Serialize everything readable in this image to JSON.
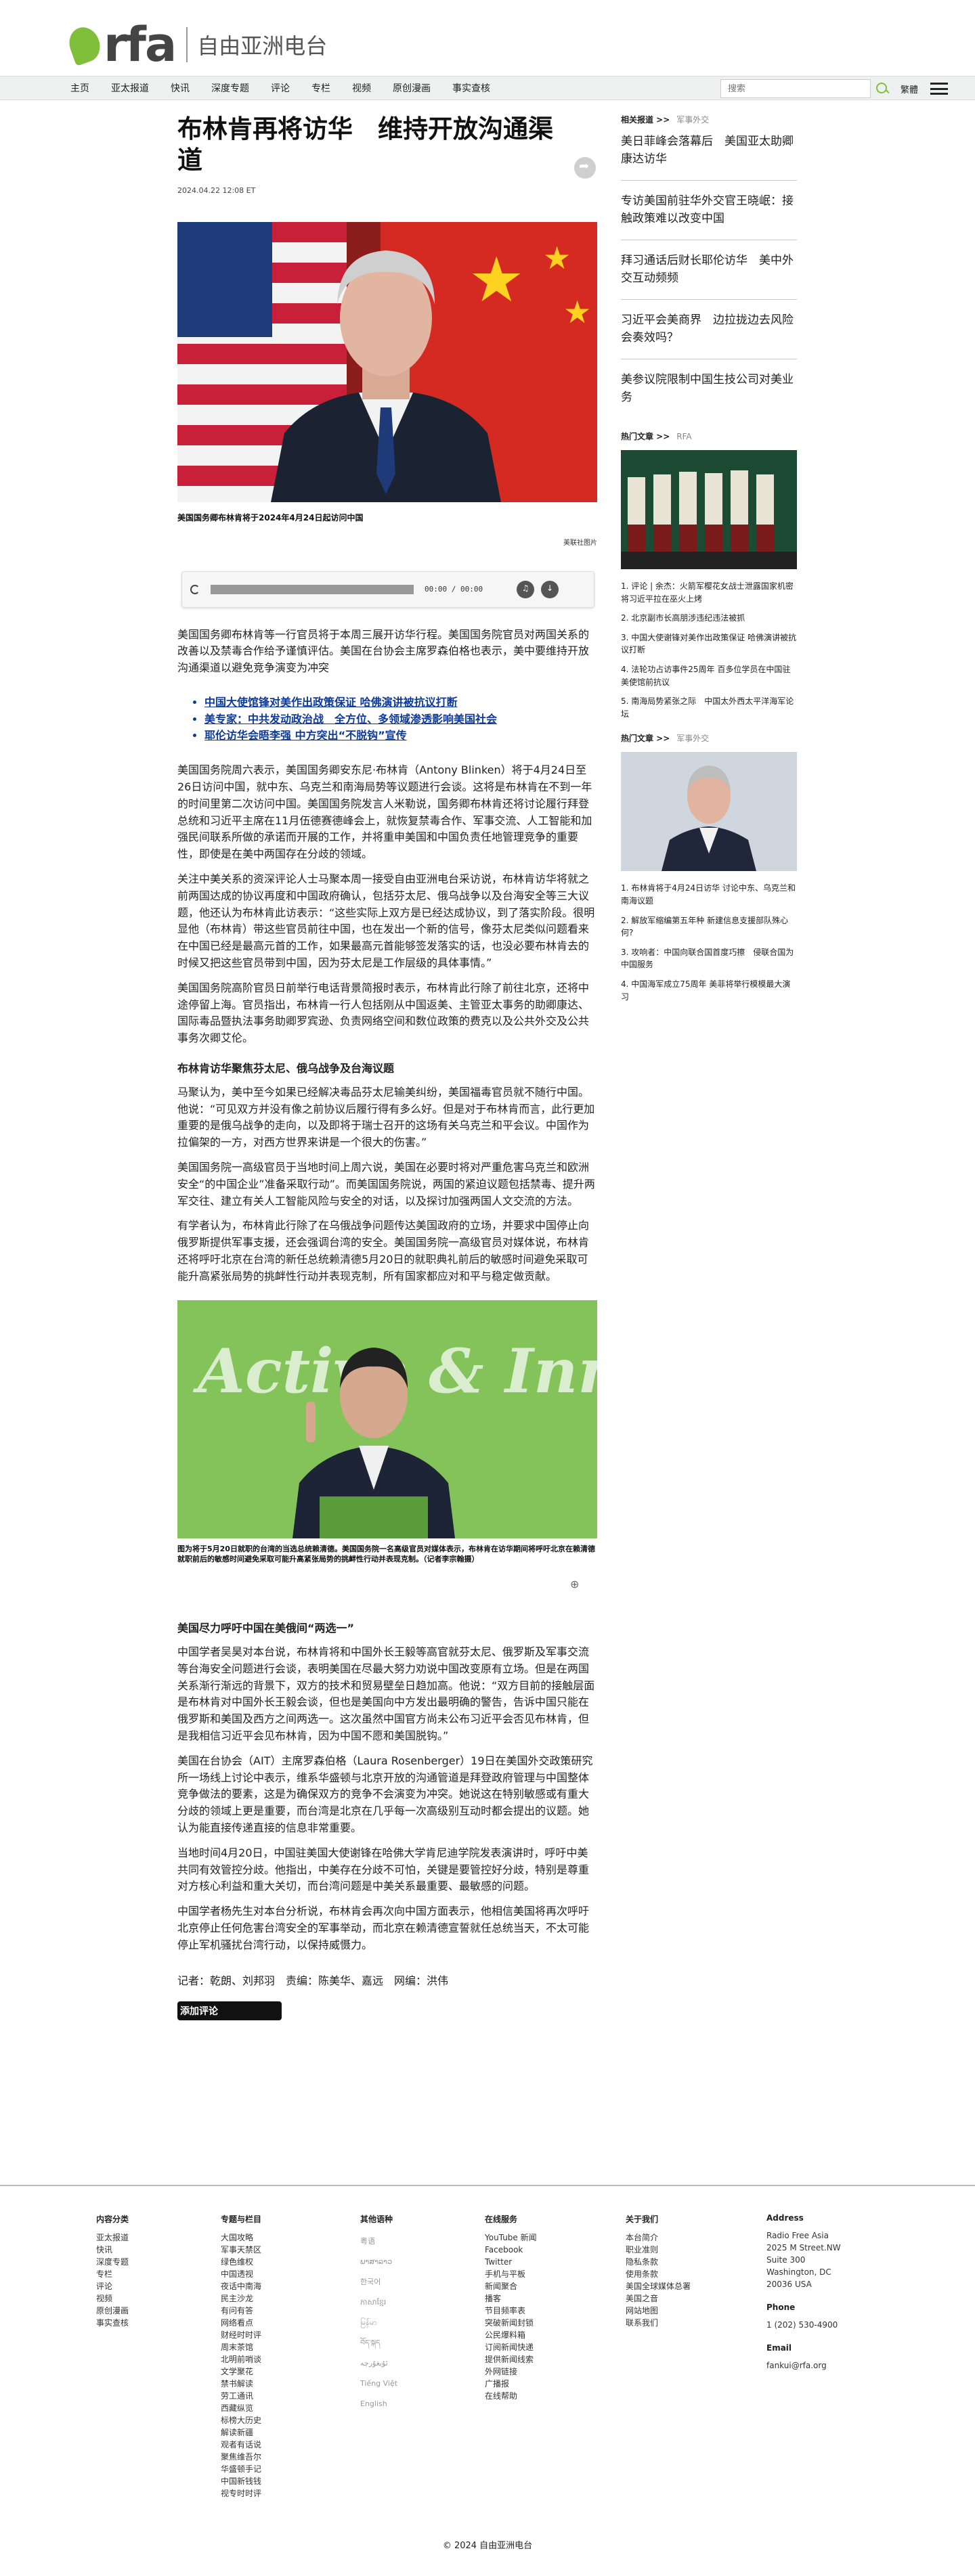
{
  "brand": {
    "logo_text": "rfa",
    "name": "自由亚洲电台"
  },
  "nav": {
    "items": [
      "主页",
      "亚太报道",
      "快讯",
      "深度专题",
      "评论",
      "专栏",
      "视频",
      "原创漫画",
      "事实查核"
    ],
    "search_placeholder": "搜索",
    "lang": "繁體"
  },
  "article": {
    "title": "布林肯再将访华　维持开放沟通渠道",
    "date": "2024.04.22 12:08 ET",
    "hero_caption": "美国国务卿布林肯将于2024年4月24日起访问中国",
    "hero_credit": "美联社图片",
    "audio_time": "00:00 / 00:00",
    "lead": "美国国务卿布林肯等一行官员将于本周三展开访华行程。美国国务院官员对两国关系的改善以及禁毒合作给予谨慎评估。美国在台协会主席罗森伯格也表示，美中要维持开放沟通渠道以避免竞争演变为冲突",
    "related": [
      "中国大使馆锋对美作出政策保证 哈佛演讲被抗议打断",
      "美专家：中共发动政治战　全方位、多领域渗透影响美国社会",
      "耶伦访华会晤李强 中方突出“不脱钩”宣传"
    ],
    "paragraphs_1": [
      "美国国务院周六表示，美国国务卿安东尼·布林肯（Antony Blinken）将于4月24日至26日访问中国，就中东、乌克兰和南海局势等议题进行会谈。这将是布林肯在不到一年的时间里第二次访问中国。美国国务院发言人米勒说，国务卿布林肯还将讨论履行拜登总统和习近平主席在11月伍德赛德峰会上，就恢复禁毒合作、军事交流、人工智能和加强民间联系所做的承诺而开展的工作，并将重申美国和中国负责任地管理竞争的重要性，即使是在美中两国存在分歧的领域。",
      "关注中美关系的资深评论人士马聚本周一接受自由亚洲电台采访说，布林肯访华将就之前两国达成的协议再度和中国政府确认，包括芬太尼、俄乌战争以及台海安全等三大议题，他还认为布林肯此访表示：“这些实际上双方是已经达成协议，到了落实阶段。很明显他（布林肯）带这些官员前往中国，也在发出一个新的信号，像芬太尼类似问题看来在中国已经是最高元首的工作，如果最高元首能够签发落实的话，也没必要布林肯去的时候又把这些官员带到中国，因为芬太尼是工作层级的具体事情。”",
      "美国国务院高阶官员日前举行电话背景简报时表示，布林肯此行除了前往北京，还将中途停留上海。官员指出，布林肯一行人包括刚从中国返美、主管亚太事务的助卿康达、国际毒品暨执法事务助卿罗宾逊、负责网络空间和数位政策的费克以及公共外交及公共事务次卿艾伦。"
    ],
    "subhead_1": "布林肯访华聚焦芬太尼、俄乌战争及台海议题",
    "paragraphs_2": [
      "马聚认为，美中至今如果已经解决毒品芬太尼输美纠纷，美国福毒官员就不随行中国。他说：“可见双方并没有像之前协议后履行得有多么好。但是对于布林肯而言，此行更加重要的是俄乌战争的走向，以及即将于瑞士召开的这场有关乌克兰和平会议。中国作为拉偏架的一方，对西方世界来讲是一个很大的伤害。”",
      "美国国务院一高级官员于当地时间上周六说，美国在必要时将对严重危害乌克兰和欧洲安全“的中国企业”准备采取行动”。而美国国务院说，两国的紧迫议题包括禁毒、提升两军交往、建立有关人工智能风险与安全的对话，以及探讨加强两国人文交流的方法。",
      "有学者认为，布林肯此行除了在乌俄战争问题传达美国政府的立场，并要求中国停止向俄罗斯提供军事支援，还会强调台湾的安全。美国国务院一高级官员对媒体说，布林肯还将呼吁北京在台湾的新任总统赖清德5月20日的就职典礼前后的敏感时间避免采取可能升高紧张局势的挑衅性行动并表现克制，所有国家都应对和平与稳定做贡献。"
    ],
    "second_img_word": "Active & Inn",
    "second_caption": "图为将于5月20日就职的台湾的当选总统赖清德。美国国务院一名高级官员对媒体表示，布林肯在访华期间将呼吁北京在赖清德就职前后的敏感时间避免采取可能升高紧张局势的挑衅性行动并表现克制。（记者李宗翰摄）",
    "subhead_2": "美国尽力呼吁中国在美俄间“两选一”",
    "paragraphs_3": [
      "中国学者吴昊对本台说，布林肯将和中国外长王毅等高官就芬太尼、俄罗斯及军事交流等台海安全问题进行会谈，表明美国在尽最大努力劝说中国改变原有立场。但是在两国关系渐行渐远的背景下，双方的技术和贸易壁垒日趋加高。他说：“双方目前的接触层面是布林肯对中国外长王毅会谈，但也是美国向中方发出最明确的警告，告诉中国只能在俄罗斯和美国及西方之间两选一。这次虽然中国官方尚未公布习近平会否见布林肯，但是我相信习近平会见布林肯，因为中国不愿和美国脱钩。”",
      "美国在台协会（AIT）主席罗森伯格（Laura Rosenberger）19日在美国外交政策研究所一场线上讨论中表示，维系华盛顿与北京开放的沟通管道是拜登政府管理与中国整体竞争做法的要素，这是为确保双方的竞争不会演变为冲突。她说这在特别敏感或有重大分歧的领域上更是重要，而台湾是北京在几乎每一次高级别互动时都会提出的议题。她认为能直接传递直接的信息非常重要。",
      "当地时间4月20日，中国驻美国大使谢锋在哈佛大学肯尼迪学院发表演讲时，呼吁中美共同有效管控分歧。他指出，中美存在分歧不可怕，关键是要管控好分歧，特别是尊重对方核心利益和重大关切，而台湾问题是中美关系最重要、最敏感的问题。",
      "中国学者杨先生对本台分析说，布林肯会再次向中国方面表示，他相信美国将再次呼吁北京停止任何危害台湾安全的军事举动，而北京在赖清德宣誓就任总统当天，不太可能停止军机骚扰台湾行动，以保持威慑力。"
    ],
    "byline": "记者：乾朗、刘邦羽　责编：陈美华、嘉远　网编：洪伟",
    "comment_btn": "添加评论"
  },
  "sidebar": {
    "related_head": "相关报道 >>",
    "related_sub": "军事外交",
    "related_items": [
      "美日菲峰会落幕后　美国亚太助卿康达访华",
      "专访美国前驻华外交官王晓岷：接触政策难以改变中国",
      "拜习通话后财长耶伦访华　美中外交互动频频",
      "习近平会美商界　边拉拢边去风险会奏效吗？",
      "美参议院限制中国生技公司对美业务"
    ],
    "hot_head": "热门文章 >>",
    "hot_sub": "RFA",
    "hot_items": [
      "1. 评论 | 余杰：火箭军樱花女战士泄露国家机密 将习近平拉在巫火上烤",
      "2. 北京副市长高朋涉违纪违法被抓",
      "3. 中国大使谢锋对美作出政策保证 哈佛演讲被抗议打断",
      "4. 法轮功占访事件25周年 百多位学员在中国驻美使馆前抗议",
      "5. 南海局势紧张之际　中国太外西太平洋海军论坛"
    ],
    "mil_head": "热门文章 >>",
    "mil_sub": "军事外交",
    "mil_items": [
      "1. 布林肯将于4月24日访华 讨论中东、乌克兰和南海议题",
      "2. 解放军缩编第五年种 新建信息支援部队殊心何?",
      "3. 攻响者：中国向联合国首度巧擦　侵联合国为中国服务",
      "4. 中国海军成立75周年 美菲将举行模模最大演习"
    ]
  },
  "footer": {
    "cols": [
      {
        "title": "内容分类",
        "items": [
          "亚太报道",
          "快讯",
          "深度专题",
          "专栏",
          "评论",
          "视频",
          "原创漫画",
          "事实查核"
        ]
      },
      {
        "title": "专题与栏目",
        "items": [
          "大国攻略",
          "军事天禁区",
          "绿色维权",
          "中国透视",
          "夜话中南海",
          "民主沙龙",
          "有问有答",
          "网络看点",
          "财经时时评",
          "周末茶馆",
          "北明前哨谈",
          "文学聚花",
          "禁书解读",
          "劳工通讯",
          "西藏纵览",
          "标榜大历史",
          "解读新疆",
          "观者有话说",
          "聚焦维吾尔",
          "华盛顿手记",
          "中国新钱钱",
          "视专时时评"
        ]
      },
      {
        "title": "其他语种",
        "items": []
      },
      {
        "title": "在线服务",
        "items": [
          "YouTube 新闻",
          "Facebook",
          "Twitter",
          "手机与平板",
          "新闻聚合",
          "播客",
          "节目频率表",
          "突破新闻封锁",
          "公民爆料箱",
          "订阅新闻快递",
          "提供新闻线索",
          "外网链接",
          "广播报",
          "在线帮助"
        ]
      },
      {
        "title": "关于我们",
        "items": [
          "本台简介",
          "职业准则",
          "隐私条款",
          "使用条款",
          "美国全球媒体总署",
          "美国之音",
          "网站地图",
          "联系我们"
        ]
      }
    ],
    "languages": [
      "粤语",
      "ພາສາລາວ",
      "한국어",
      "ភាសាខ្មែរ",
      "မြန်မာ",
      "བོད་སྐད",
      "ئۇيغۇرچە",
      "Tiếng Việt",
      "English"
    ],
    "address_title": "Address",
    "address_lines": [
      "Radio Free Asia",
      "2025 M Street.NW",
      "Suite 300",
      "Washington, DC",
      "20036 USA"
    ],
    "phone_title": "Phone",
    "phone": "1 (202) 530-4900",
    "email_title": "Email",
    "email": "fankui@rfa.org",
    "copyright": "© 2024 自由亚洲电台"
  }
}
